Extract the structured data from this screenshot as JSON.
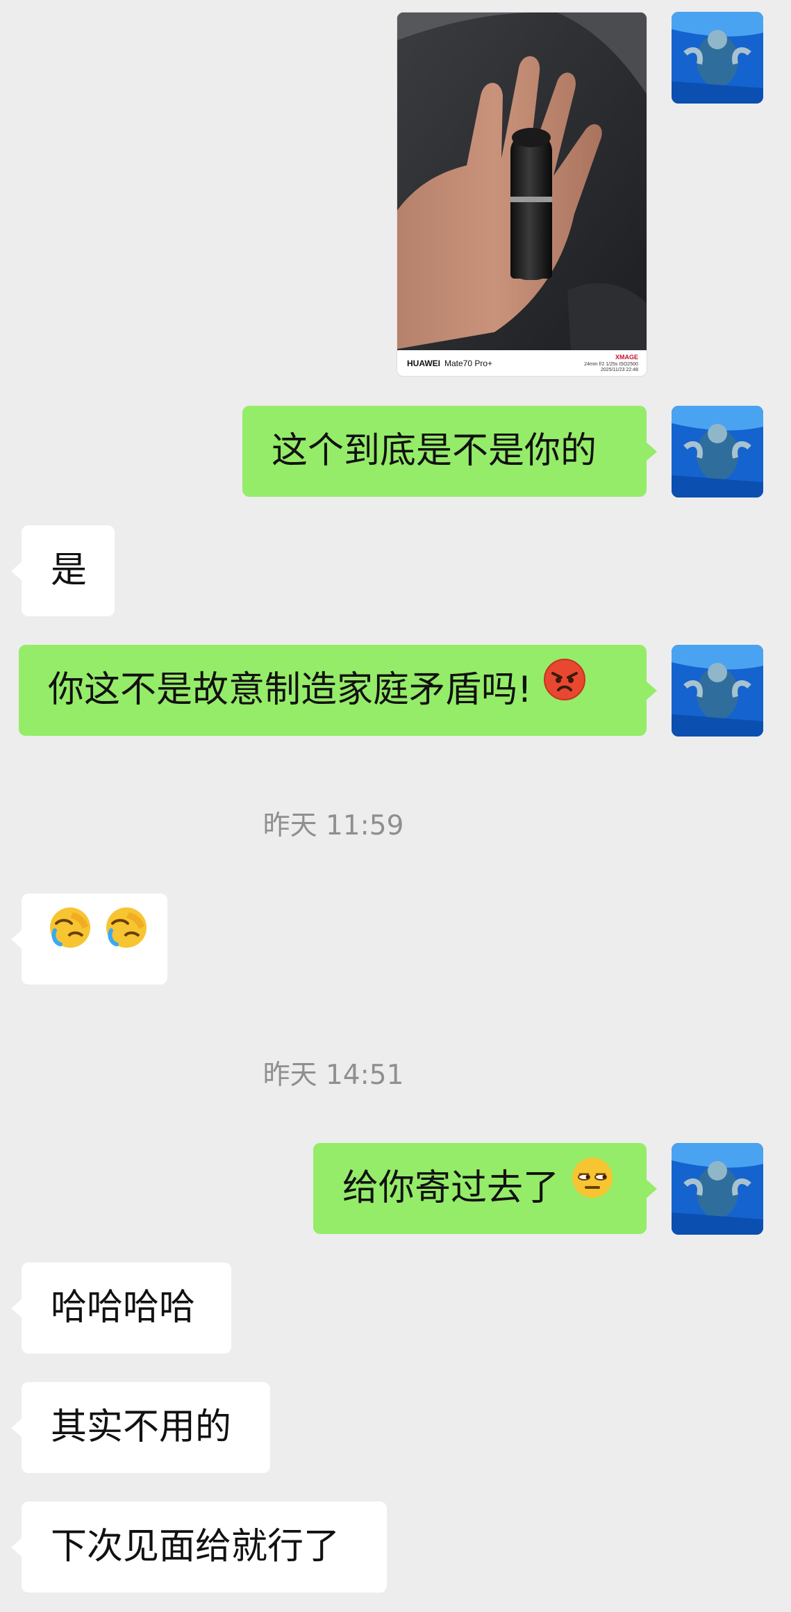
{
  "photo_caption": {
    "brand": "HUAWEI",
    "model": "Mate70 Pro+",
    "logo": "XMAGE",
    "exif_line1": "24mm f/2 1/25s ISO2500",
    "exif_line2": "2025/11/23 22:48"
  },
  "messages": [
    {
      "sender": "me",
      "type": "image"
    },
    {
      "sender": "me",
      "text": "这个到底是不是你的"
    },
    {
      "sender": "them",
      "text": "是"
    },
    {
      "sender": "me",
      "text": "你这不是故意制造家庭矛盾吗!",
      "emoji": "angry-face-icon"
    },
    {
      "type": "time",
      "text": "昨天 11:59"
    },
    {
      "sender": "them",
      "emoji": "face-palm-crying-icon x2"
    },
    {
      "type": "time",
      "text": "昨天 14:51"
    },
    {
      "sender": "me",
      "text": "给你寄过去了",
      "emoji": "side-eye-face-icon"
    },
    {
      "sender": "them",
      "text": "哈哈哈哈"
    },
    {
      "sender": "them",
      "text": "其实不用的"
    },
    {
      "sender": "them",
      "text": "下次见面给就行了"
    }
  ],
  "colors": {
    "background": "#ededed",
    "my_bubble": "#95ec69",
    "their_bubble": "#ffffff",
    "time": "#8f8f8f"
  }
}
